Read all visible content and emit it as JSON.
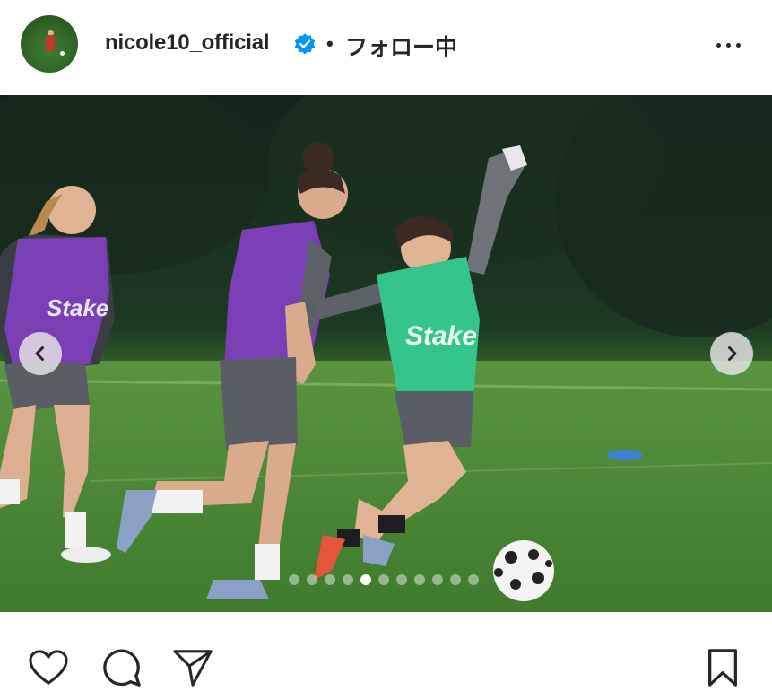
{
  "post": {
    "username": "nicole10_official",
    "verified": true,
    "separator": "•",
    "follow_label": "フォロー中",
    "more_icon": "more-horizontal-icon"
  },
  "photo": {
    "slide_count": 11,
    "active_slide": 5,
    "bib_text": "Stake",
    "prev_icon": "chevron-left-icon",
    "next_icon": "chevron-right-icon"
  },
  "actions": {
    "like_icon": "heart-icon",
    "comment_icon": "comment-icon",
    "share_icon": "paper-plane-icon",
    "save_icon": "bookmark-icon"
  },
  "colors": {
    "text": "#262626",
    "verified_blue": "#0095f6",
    "grass": "#4e8a3a",
    "bib_green": "#35c48a",
    "bib_purple": "#7a3fb5"
  }
}
